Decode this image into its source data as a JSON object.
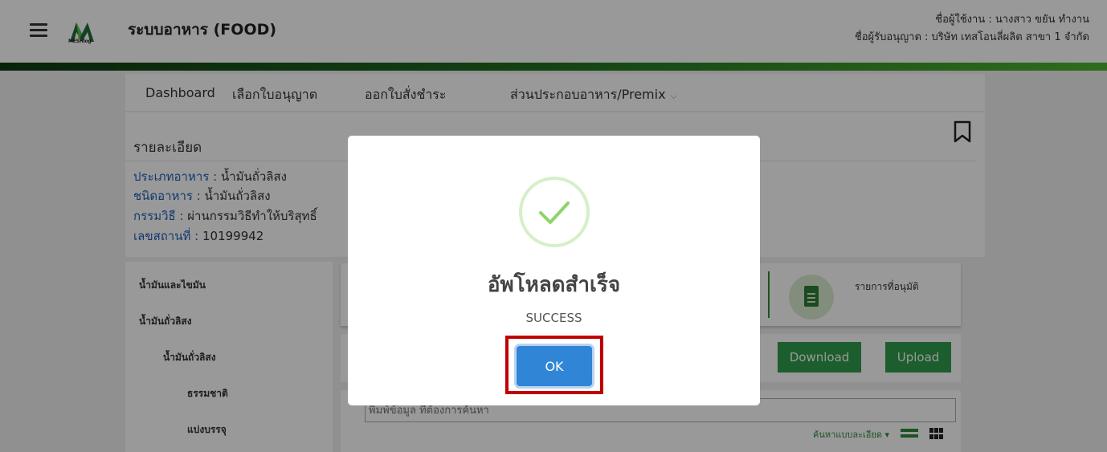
{
  "header": {
    "logo_text": "MESHlog",
    "app_title": "ระบบอาหาร (FOOD)",
    "username_line": "ชื่อผู้ใช้งาน : นางสาว ขยัน ทำงาน",
    "licensee_line": "ชื่อผู้รับอนุญาต : บริษัท เทสโอนลี่ผลิต สาขา 1 จำกัด"
  },
  "nav": {
    "items": [
      "Dashboard",
      "เลือกใบอนุญาต",
      "ออกใบสั่งชำระ",
      "ส่วนประกอบอาหาร/Premix"
    ]
  },
  "detail": {
    "title": "รายละเอียด",
    "food_type_label": "ประเภทอาหาร :",
    "food_type_value": "น้ำมันถั่วลิสง",
    "food_kind_label": "ชนิดอาหาร :",
    "food_kind_value": "น้ำมันถั่วลิสง",
    "process_label": "กรรมวิธี :",
    "process_value": "ผ่านกรรมวิธีทำให้บริสุทธิ์",
    "location_label": "เลขสถานที่ :",
    "location_value": "10199942"
  },
  "sidebar": {
    "items": [
      "น้ำมันและไขมัน",
      "น้ำมันถั่วลิสง",
      "น้ำมันถั่วลิสง",
      "ธรรมชาติ",
      "แบ่งบรรจุ"
    ]
  },
  "main": {
    "approved_label": "รายการที่อนุมัติ",
    "download_label": "Download",
    "upload_label": "Upload",
    "search_placeholder": "พิมพ์ข้อมูล ที่ต้องการค้นหา",
    "advanced_search_label": "ค้นหาแบบละเอียด ▾"
  },
  "modal": {
    "title": "อัพโหลดสำเร็จ",
    "text": "SUCCESS",
    "ok_label": "OK"
  },
  "colors": {
    "accent_green": "#2f9d4b",
    "ok_blue": "#3085d6",
    "highlight_red": "#c00000",
    "label_blue": "#1d5fb8"
  }
}
